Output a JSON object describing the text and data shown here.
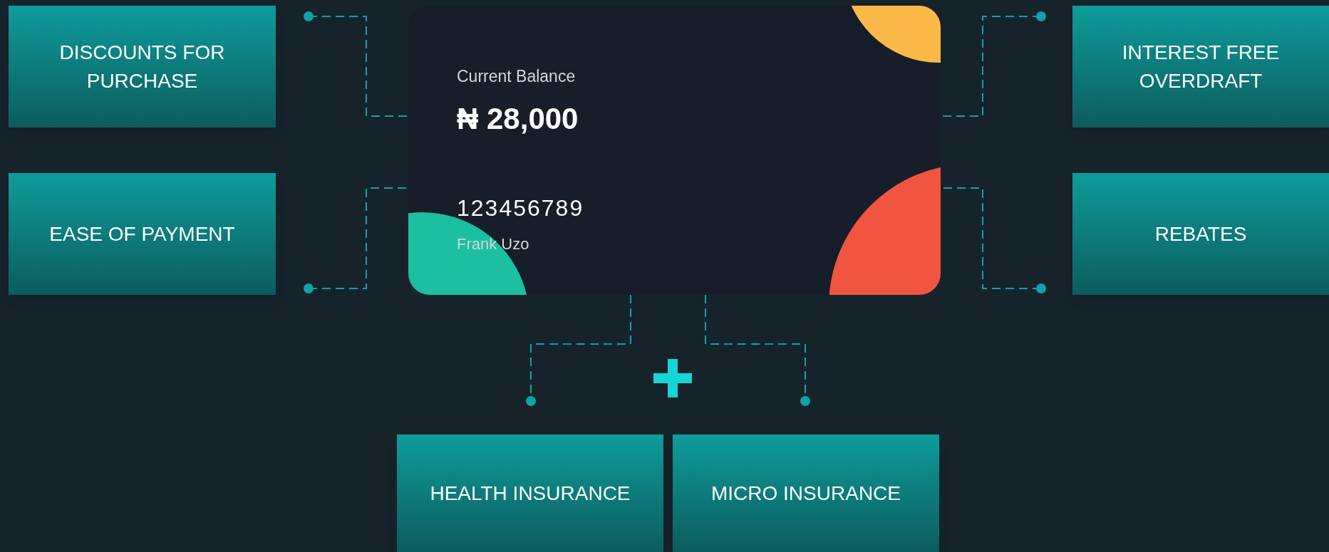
{
  "left_features": [
    {
      "label": "DISCOUNTS FOR PURCHASE"
    },
    {
      "label": "EASE OF PAYMENT"
    }
  ],
  "card": {
    "balance_label": "Current Balance",
    "balance": "₦ 28,000",
    "number": "123456789",
    "holder": "Frank Uzo"
  },
  "right_features": [
    {
      "label": "INTEREST FREE OVERDRAFT"
    },
    {
      "label": "REBATES"
    }
  ],
  "bottom_features": [
    {
      "label": "HEALTH INSURANCE"
    },
    {
      "label": "MICRO INSURANCE"
    }
  ]
}
